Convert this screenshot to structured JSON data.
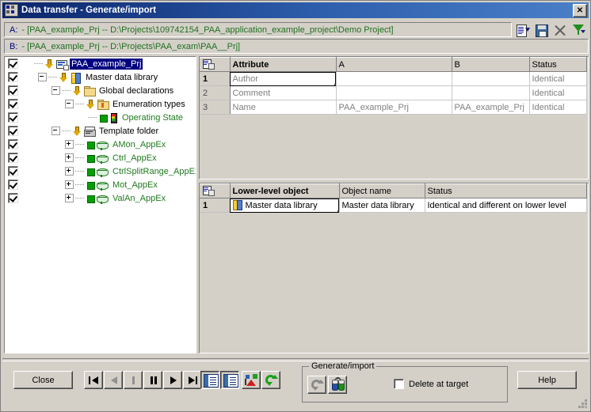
{
  "window": {
    "title": "Data transfer - Generate/import",
    "close_label": "✕",
    "app_icon": "data-transfer-icon"
  },
  "paths": {
    "a_label": "A:",
    "a_value": "- [PAA_example_Prj -- D:\\Projects\\109742154_PAA_application_example_project\\Demo Project]",
    "b_label": "B:",
    "b_value": "- [PAA_example_Prj -- D:\\Projects\\PAA_exam\\PAA__Prj]"
  },
  "toolbar_icons": [
    {
      "name": "report-icon"
    },
    {
      "name": "save-icon"
    },
    {
      "name": "delete-icon"
    },
    {
      "name": "filter-icon"
    }
  ],
  "tree": {
    "items": [
      {
        "label": "PAA_example_Prj",
        "indent": 0,
        "checked": true,
        "selected": true,
        "expander": "none",
        "icon": "project-icon",
        "color": "sel"
      },
      {
        "label": "Master data library",
        "indent": 1,
        "checked": true,
        "selected": false,
        "expander": "minus",
        "icon": "master-library-icon",
        "color": "black"
      },
      {
        "label": "Global declarations",
        "indent": 2,
        "checked": true,
        "selected": false,
        "expander": "minus",
        "icon": "folder-icon",
        "color": "black"
      },
      {
        "label": "Enumeration types",
        "indent": 3,
        "checked": true,
        "selected": false,
        "expander": "minus",
        "icon": "enum-folder-icon",
        "color": "black"
      },
      {
        "label": "Operating State",
        "indent": 4,
        "checked": true,
        "selected": false,
        "expander": "none",
        "icon": "traffic-light-icon",
        "color": "green"
      },
      {
        "label": "Template folder",
        "indent": 2,
        "checked": true,
        "selected": false,
        "expander": "minus",
        "icon": "template-folder-icon",
        "color": "black"
      },
      {
        "label": "AMon_AppEx",
        "indent": 3,
        "checked": true,
        "selected": false,
        "expander": "plus",
        "icon": "block-icon",
        "color": "green"
      },
      {
        "label": "Ctrl_AppEx",
        "indent": 3,
        "checked": true,
        "selected": false,
        "expander": "plus",
        "icon": "block-icon",
        "color": "green"
      },
      {
        "label": "CtrlSplitRange_AppEx",
        "indent": 3,
        "checked": true,
        "selected": false,
        "expander": "plus",
        "icon": "block-icon",
        "color": "green"
      },
      {
        "label": "Mot_AppEx",
        "indent": 3,
        "checked": true,
        "selected": false,
        "expander": "plus",
        "icon": "block-icon",
        "color": "green"
      },
      {
        "label": "ValAn_AppEx",
        "indent": 3,
        "checked": true,
        "selected": false,
        "expander": "plus",
        "icon": "block-icon",
        "color": "green"
      }
    ]
  },
  "attribute_table": {
    "headers": [
      "",
      "Attribute",
      "A",
      "B",
      "Status"
    ],
    "rows": [
      {
        "num": "1",
        "attribute": "Author",
        "a": "",
        "b": "",
        "status": "Identical",
        "selected": true
      },
      {
        "num": "2",
        "attribute": "Comment",
        "a": "",
        "b": "",
        "status": "Identical",
        "selected": false
      },
      {
        "num": "3",
        "attribute": "Name",
        "a": "PAA_example_Prj",
        "b": "PAA_example_Prj",
        "status": "Identical",
        "selected": false
      }
    ]
  },
  "lower_table": {
    "headers": [
      "",
      "Lower-level object",
      "Object name",
      "Status"
    ],
    "rows": [
      {
        "num": "1",
        "object": "Master data library",
        "object_name": "Master data library",
        "status": "Identical and different on lower level",
        "selected": true
      }
    ]
  },
  "bottom": {
    "close_label": "Close",
    "help_label": "Help",
    "nav_buttons": [
      {
        "name": "first-button",
        "enabled": true
      },
      {
        "name": "previous-button",
        "enabled": false
      },
      {
        "name": "step-button",
        "enabled": false
      },
      {
        "name": "pause-button",
        "enabled": true
      },
      {
        "name": "play-button",
        "enabled": true
      },
      {
        "name": "last-button",
        "enabled": true
      }
    ],
    "view_buttons": [
      {
        "name": "detail-view-button"
      },
      {
        "name": "list-view-button"
      }
    ],
    "misc_buttons": [
      {
        "name": "compare-button"
      },
      {
        "name": "refresh-button"
      }
    ],
    "group": {
      "title": "Generate/import",
      "buttons": [
        {
          "name": "regenerate-button",
          "enabled": false
        },
        {
          "name": "transfer-button",
          "enabled": true
        }
      ],
      "checkbox_label": "Delete at target",
      "checkbox_checked": false
    }
  },
  "colors": {
    "title_gradient_start": "#0a246a",
    "title_gradient_end": "#4a80c8",
    "face": "#d4d0c8",
    "selection": "#000080",
    "path_text": "#207020",
    "tree_green": "#1f7a1f"
  }
}
